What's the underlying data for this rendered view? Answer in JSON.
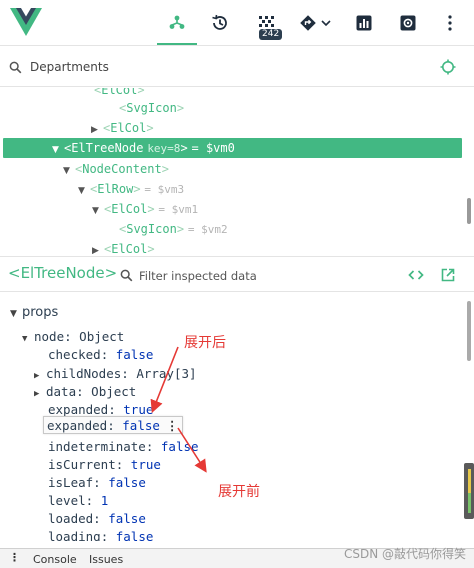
{
  "toolbar": {
    "logo": "vue-logo",
    "buttons": [
      {
        "id": "components",
        "icon": "components-icon",
        "active": true
      },
      {
        "id": "timeline",
        "icon": "history-icon"
      },
      {
        "id": "performance",
        "icon": "performance-icon",
        "badge": "242"
      },
      {
        "id": "routes",
        "icon": "routes-icon"
      },
      {
        "id": "stats",
        "icon": "stats-icon"
      },
      {
        "id": "settings",
        "icon": "settings-icon"
      }
    ],
    "accent": "#42b883"
  },
  "search": {
    "placeholder": "Departments"
  },
  "tree": {
    "rows": [
      {
        "tag": "ElCol",
        "indent": 0,
        "meta": ""
      },
      {
        "tag": "SvgIcon",
        "meta": ""
      },
      {
        "tag": "ElCol",
        "meta": ""
      },
      {
        "tag": "ElTreeNode",
        "key": "key=8",
        "vm": "= $vm0",
        "selected": true
      },
      {
        "tag": "NodeContent",
        "meta": ""
      },
      {
        "tag": "ElRow",
        "meta": "= $vm3"
      },
      {
        "tag": "ElCol",
        "meta": "= $vm1"
      },
      {
        "tag": "SvgIcon",
        "meta": "= $vm2"
      },
      {
        "tag": "ElCol",
        "meta": ""
      }
    ],
    "selected_color": "#42b883"
  },
  "inspector": {
    "title": "<ElTreeNode>",
    "filter_placeholder": "Filter inspected data"
  },
  "props": {
    "section": "props",
    "rows": [
      {
        "key": "node",
        "value": "Object",
        "type": "obj",
        "expanded": true
      },
      {
        "key": "checked",
        "value": "false",
        "type": "bool"
      },
      {
        "key": "childNodes",
        "value": "Array[3]",
        "type": "obj",
        "collapsed": true
      },
      {
        "key": "data",
        "value": "Object",
        "type": "obj",
        "collapsed": true
      },
      {
        "key": "expanded",
        "value": "true",
        "type": "bool"
      },
      {
        "key": "expanded",
        "value": "false",
        "type": "bool",
        "highlighted": true
      },
      {
        "key": "indeterminate",
        "value": "false",
        "type": "bool"
      },
      {
        "key": "isCurrent",
        "value": "true",
        "type": "bool"
      },
      {
        "key": "isLeaf",
        "value": "false",
        "type": "bool"
      },
      {
        "key": "level",
        "value": "1",
        "type": "num"
      },
      {
        "key": "loaded",
        "value": "false",
        "type": "bool"
      },
      {
        "key": "loading",
        "value": "false",
        "type": "bool"
      }
    ]
  },
  "annotations": {
    "after": "展开后",
    "before": "展开前",
    "color": "#e53935"
  },
  "drawer": {
    "menu": "⋮",
    "tabs": [
      "Console",
      "Issues"
    ]
  },
  "watermark": "CSDN @敲代码你得笑"
}
